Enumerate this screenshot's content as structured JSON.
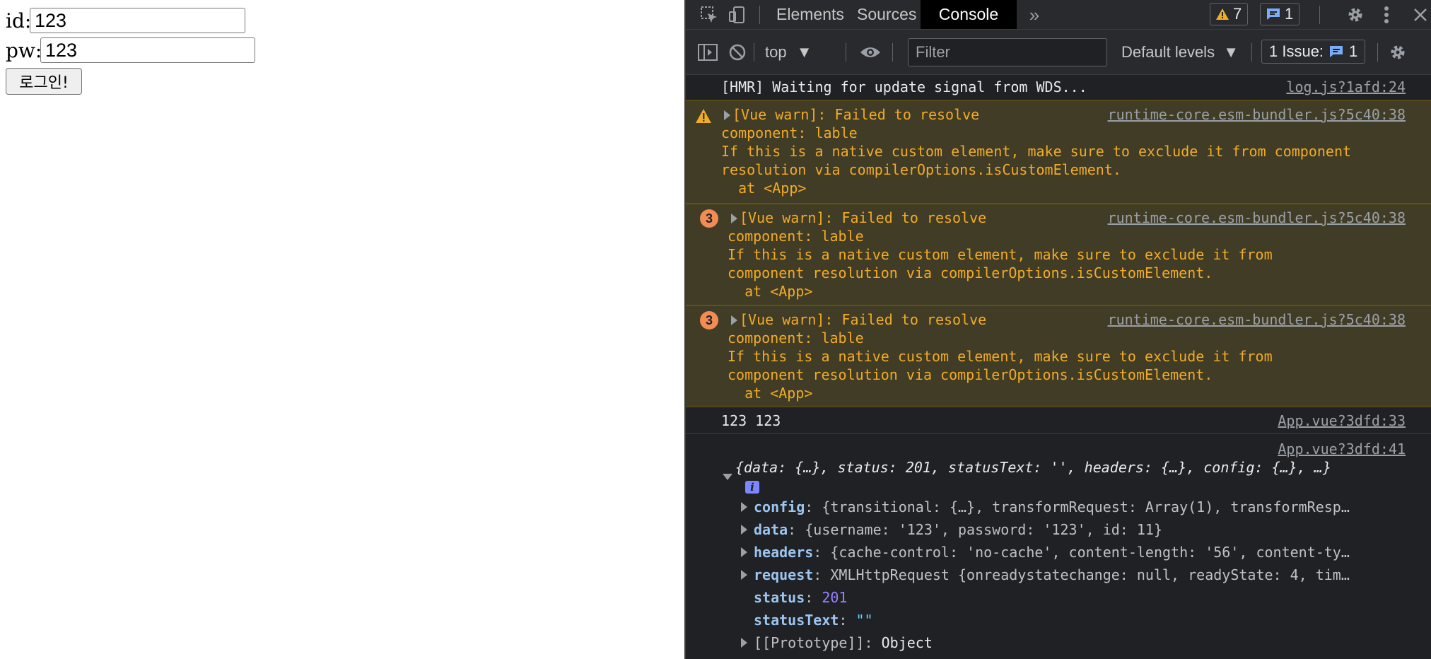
{
  "page": {
    "id_label": "id:",
    "id_value": "123",
    "pw_label": "pw:",
    "pw_value": "123",
    "login_button": "로그인!"
  },
  "devtools": {
    "tabs": [
      "Elements",
      "Sources",
      "Console"
    ],
    "active_tab": "Console",
    "more_tabs_icon": "double-chevron-icon",
    "warnings_count": "7",
    "messages_count": "1",
    "toolbar": {
      "context": "top",
      "filter_placeholder": "Filter",
      "levels": "Default levels",
      "issues_label": "1 Issue:",
      "issues_count": "1"
    },
    "colors": {
      "panel_bg": "#202124",
      "warn_bg": "#413c26",
      "warn_text": "#f2ab26",
      "badge_orange": "#f28b54",
      "info_blue": "#7c87ff"
    },
    "messages": [
      {
        "text": "[HMR] Waiting for update signal from WDS...",
        "source": "log.js?1afd:24"
      },
      {
        "lines": [
          "[Vue warn]: Failed to resolve",
          "component: lable",
          "If this is a native custom element, make sure to exclude it from component",
          "resolution via compilerOptions.isCustomElement.",
          "  at <App>"
        ],
        "source": "runtime-core.esm-bundler.js?5c40:38"
      },
      {
        "count": "3",
        "lines": [
          "[Vue warn]: Failed to resolve",
          "component: lable",
          "If this is a native custom element, make sure to exclude it from",
          "component resolution via compilerOptions.isCustomElement.",
          "  at <App>"
        ],
        "source": "runtime-core.esm-bundler.js?5c40:38"
      },
      {
        "count": "3",
        "lines": [
          "[Vue warn]: Failed to resolve",
          "component: lable",
          "If this is a native custom element, make sure to exclude it from",
          "component resolution via compilerOptions.isCustomElement.",
          "  at <App>"
        ],
        "source": "runtime-core.esm-bundler.js?5c40:38"
      },
      {
        "text": "123 123",
        "source": "App.vue?3dfd:33"
      },
      {
        "source": "App.vue?3dfd:41",
        "summary": "{data: {…}, status: 201, statusText: '', headers: {…}, config: {…}, …}",
        "info_glyph": "i",
        "properties": [
          {
            "key": "config",
            "value": "{transitional: {…}, transformRequest: Array(1), transformResp…",
            "expandable": true
          },
          {
            "key": "data",
            "value": "{username: '123', password: '123', id: 11}",
            "expandable": true
          },
          {
            "key": "headers",
            "value": "{cache-control: 'no-cache', content-length: '56', content-ty…",
            "expandable": true
          },
          {
            "key": "request",
            "value": "XMLHttpRequest {onreadystatechange: null, readyState: 4, tim…",
            "expandable": true
          },
          {
            "key": "status",
            "value": "201",
            "expandable": false
          },
          {
            "key": "statusText",
            "value": "\"\"",
            "expandable": false
          },
          {
            "key": "[[Prototype]]",
            "value": "Object",
            "expandable": true
          }
        ]
      }
    ]
  }
}
